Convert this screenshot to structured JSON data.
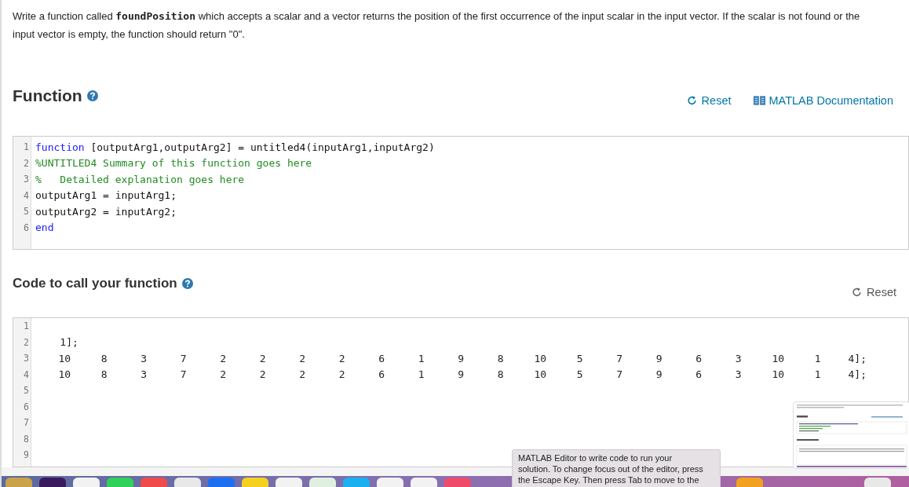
{
  "instructions": "Write a function called **foundPosition** which accepts a scalar and a vector returns the position of the first occurrence of the input scalar in the input vector.  If the scalar is not found or the input vector is empty, the function should return \"0\".",
  "function_section": {
    "heading": "Function",
    "reset": "Reset",
    "documentation": "MATLAB Documentation",
    "editor": {
      "lines": [
        {
          "number": "1",
          "tokens": [
            {
              "kind": "keyword",
              "text": "function"
            },
            {
              "kind": "plain",
              "text": " [outputArg1,outputArg2] = untitled4(inputArg1,inputArg2)"
            }
          ]
        },
        {
          "number": "2",
          "tokens": [
            {
              "kind": "comment",
              "text": "%UNTITLED4 Summary of this function goes here"
            }
          ]
        },
        {
          "number": "3",
          "tokens": [
            {
              "kind": "comment",
              "text": "%   Detailed explanation goes here"
            }
          ]
        },
        {
          "number": "4",
          "tokens": [
            {
              "kind": "plain",
              "text": "outputArg1 = inputArg1;"
            }
          ]
        },
        {
          "number": "5",
          "tokens": [
            {
              "kind": "plain",
              "text": "outputArg2 = inputArg2;"
            }
          ]
        },
        {
          "number": "6",
          "tokens": [
            {
              "kind": "keyword",
              "text": "end"
            }
          ]
        }
      ]
    }
  },
  "call_section": {
    "heading": "Code to call your function",
    "reset": "Reset",
    "editor": {
      "lines": [
        {
          "number": "1",
          "kind": "empty"
        },
        {
          "number": "2",
          "kind": "text",
          "text": "    1];"
        },
        {
          "number": "3",
          "kind": "row",
          "cells": [
            "10",
            "8",
            "3",
            "7",
            "2",
            "2",
            "2",
            "2",
            "6",
            "1",
            "9",
            "8",
            "10",
            "5",
            "7",
            "9",
            "6",
            "3",
            "10",
            "1",
            "4];"
          ]
        },
        {
          "number": "4",
          "kind": "row",
          "cells": [
            "10",
            "8",
            "3",
            "7",
            "2",
            "2",
            "2",
            "2",
            "6",
            "1",
            "9",
            "8",
            "10",
            "5",
            "7",
            "9",
            "6",
            "3",
            "10",
            "1",
            "4];"
          ]
        },
        {
          "number": "5",
          "kind": "empty"
        },
        {
          "number": "6",
          "kind": "empty"
        },
        {
          "number": "7",
          "kind": "empty"
        },
        {
          "number": "8",
          "kind": "empty"
        },
        {
          "number": "9",
          "kind": "empty"
        }
      ]
    }
  },
  "tooltip": {
    "lines": [
      "MATLAB Editor to write code to run your",
      "solution. To change focus out of the editor, press",
      "the Escape Key. Then press Tab to move to the"
    ]
  }
}
